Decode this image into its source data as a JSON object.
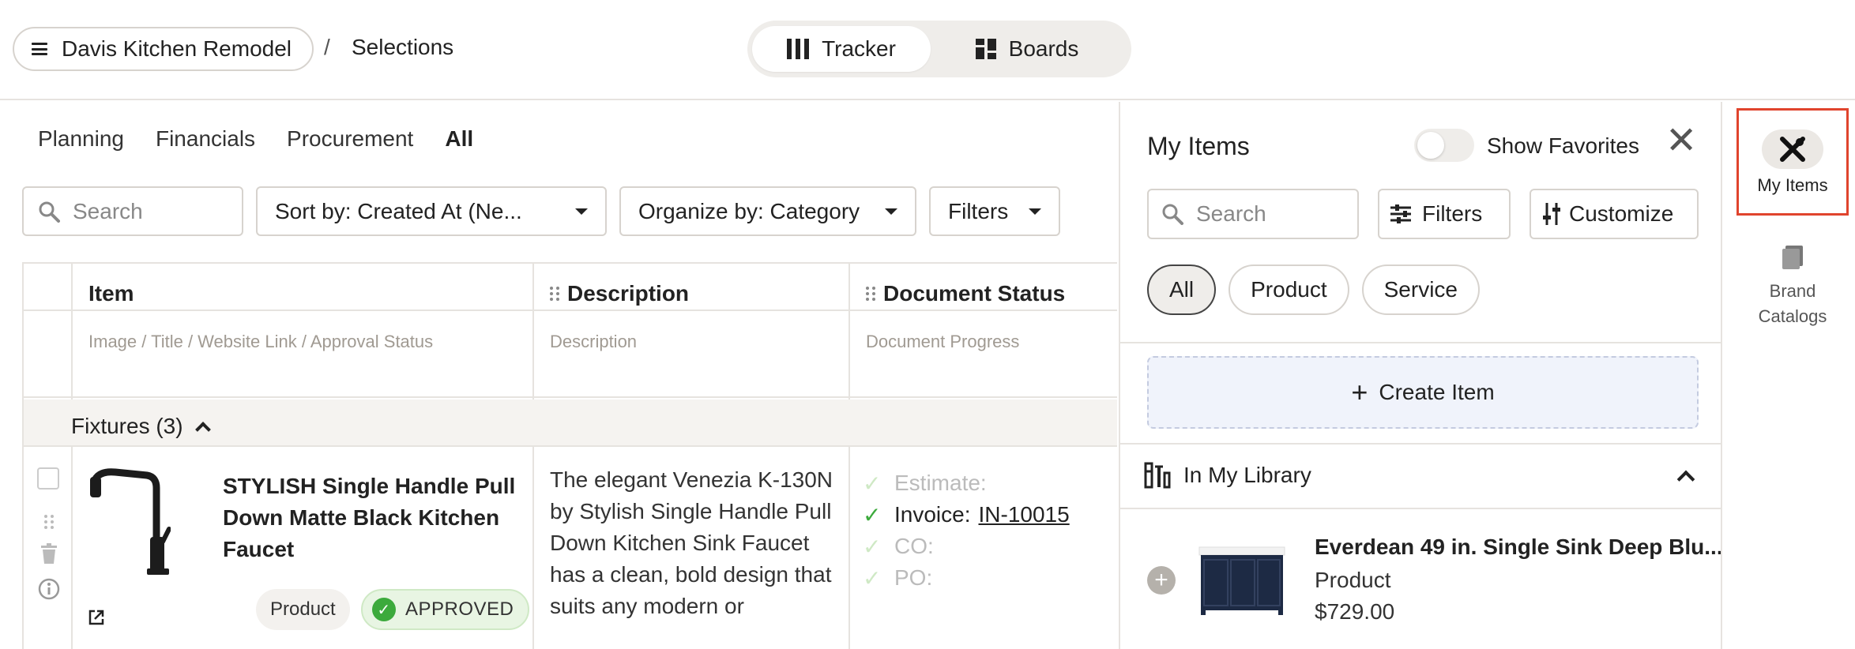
{
  "header": {
    "project_name": "Davis Kitchen Remodel",
    "breadcrumb_sep": "/",
    "breadcrumb_current": "Selections",
    "views": [
      {
        "label": "Tracker",
        "icon": "columns-icon",
        "active": true
      },
      {
        "label": "Boards",
        "icon": "boards-icon",
        "active": false
      }
    ]
  },
  "tabs": [
    "Planning",
    "Financials",
    "Procurement",
    "All"
  ],
  "active_tab": "All",
  "toolbar": {
    "search_placeholder": "Search",
    "sort_label": "Sort by: Created At (Ne...",
    "organize_label": "Organize by: Category",
    "filters_label": "Filters"
  },
  "table": {
    "columns": [
      {
        "label": "Item",
        "sub": "Image / Title / Website Link / Approval Status"
      },
      {
        "label": "Description",
        "sub": "Description"
      },
      {
        "label": "Document Status",
        "sub": "Document Progress"
      }
    ],
    "group": {
      "label": "Fixtures (3)"
    },
    "rows": [
      {
        "title": "STYLISH Single Handle Pull Down Matte Black Kitchen Faucet",
        "type_badge": "Product",
        "status_badge": "APPROVED",
        "description": "The elegant Venezia K-130N by Stylish Single Handle Pull Down Kitchen Sink Faucet has a clean, bold design that suits any modern or",
        "documents": [
          {
            "label": "Estimate:",
            "value": "",
            "done": false
          },
          {
            "label": "Invoice:",
            "value": "IN-10015",
            "done": true
          },
          {
            "label": "CO:",
            "value": "",
            "done": false
          },
          {
            "label": "PO:",
            "value": "",
            "done": false
          }
        ]
      }
    ]
  },
  "panel": {
    "title": "My Items",
    "favorites_label": "Show Favorites",
    "favorites_on": false,
    "close_symbol": "✕",
    "search_placeholder": "Search",
    "filters_label": "Filters",
    "customize_label": "Customize",
    "chips": [
      "All",
      "Product",
      "Service"
    ],
    "active_chip": "All",
    "create_label": "Create Item",
    "library_label": "In My Library",
    "library_items": [
      {
        "title": "Everdean 49 in. Single Sink Deep Blu...",
        "type": "Product",
        "price": "$729.00"
      }
    ]
  },
  "rail": {
    "my_items_label": "My Items",
    "brand_catalogs_label": "Brand\nCatalogs"
  },
  "colors": {
    "approved_green": "#3caa3c",
    "highlight_red": "#e0442d",
    "create_bg": "#f0f3fb"
  }
}
